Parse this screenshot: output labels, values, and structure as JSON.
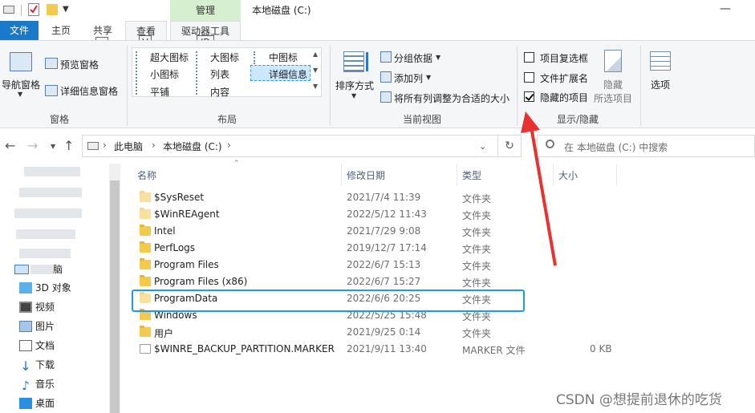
{
  "title_bar": {
    "context_tab": "管理",
    "window_title": "本地磁盘 (C:)"
  },
  "tabs": [
    {
      "label": "文件"
    },
    {
      "label": "主页"
    },
    {
      "label": "共享"
    },
    {
      "label": "查看"
    },
    {
      "label": "驱动器工具"
    }
  ],
  "keytips": [
    "S",
    "V",
    "JD"
  ],
  "ribbon": {
    "panes": {
      "nav_pane": "导航窗格",
      "preview_pane": "预览窗格",
      "details_pane": "详细信息窗格",
      "group_label": "窗格"
    },
    "layout": {
      "items": [
        "超大图标",
        "大图标",
        "中图标",
        "小图标",
        "列表",
        "详细信息",
        "平铺",
        "内容"
      ],
      "selected": "详细信息",
      "group_label": "布局"
    },
    "current_view": {
      "sort_by": "排序方式",
      "group_by": "分组依据",
      "add_column": "添加列",
      "fit_columns": "将所有列调整为合适的大小",
      "group_label": "当前视图"
    },
    "show_hide": {
      "item_checkboxes": {
        "label": "项目复选框",
        "checked": false
      },
      "file_extensions": {
        "label": "文件扩展名",
        "checked": false
      },
      "hidden_items": {
        "label": "隐藏的项目",
        "checked": true
      },
      "hide_selected": "隐藏",
      "hide_selected_2": "所选项目",
      "options": "选项",
      "group_label": "显示/隐藏"
    }
  },
  "address_bar": {
    "crumbs": [
      "此电脑",
      "本地磁盘 (C:)"
    ]
  },
  "search": {
    "placeholder": "在 本地磁盘 (C:) 中搜索"
  },
  "nav_pane": {
    "items": [
      {
        "label": "3D 对象",
        "icon": "3d-objects-icon"
      },
      {
        "label": "视频",
        "icon": "video-icon"
      },
      {
        "label": "图片",
        "icon": "pictures-icon"
      },
      {
        "label": "文档",
        "icon": "documents-icon"
      },
      {
        "label": "下载",
        "icon": "downloads-icon"
      },
      {
        "label": "音乐",
        "icon": "music-icon"
      },
      {
        "label": "桌面",
        "icon": "desktop-icon"
      }
    ],
    "this_pc_tail": "脑"
  },
  "columns": [
    "名称",
    "修改日期",
    "类型",
    "大小"
  ],
  "files": [
    {
      "name": "$SysReset",
      "date": "2021/7/4 11:39",
      "type": "文件夹",
      "size": "",
      "kind": "folder"
    },
    {
      "name": "$WinREAgent",
      "date": "2022/5/12 11:43",
      "type": "文件夹",
      "size": "",
      "kind": "folder"
    },
    {
      "name": "Intel",
      "date": "2021/7/29 9:08",
      "type": "文件夹",
      "size": "",
      "kind": "folder"
    },
    {
      "name": "PerfLogs",
      "date": "2019/12/7 17:14",
      "type": "文件夹",
      "size": "",
      "kind": "folder"
    },
    {
      "name": "Program Files",
      "date": "2022/6/7 15:13",
      "type": "文件夹",
      "size": "",
      "kind": "folder"
    },
    {
      "name": "Program Files (x86)",
      "date": "2022/6/7 15:27",
      "type": "文件夹",
      "size": "",
      "kind": "folder"
    },
    {
      "name": "ProgramData",
      "date": "2022/6/6 20:25",
      "type": "文件夹",
      "size": "",
      "kind": "folder"
    },
    {
      "name": "Windows",
      "date": "2022/5/25 15:48",
      "type": "文件夹",
      "size": "",
      "kind": "folder"
    },
    {
      "name": "用户",
      "date": "2021/9/25 0:14",
      "type": "文件夹",
      "size": "",
      "kind": "folder"
    },
    {
      "name": "$WINRE_BACKUP_PARTITION.MARKER",
      "date": "2021/9/11 13:40",
      "type": "MARKER 文件",
      "size": "0 KB",
      "kind": "file"
    }
  ],
  "watermark": "CSDN @想提前退休的吃货",
  "colors": {
    "accent": "#1979ca",
    "highlight": "#1e9be3",
    "arrow": "#e8322f",
    "context_tab": "#d6efcf"
  }
}
